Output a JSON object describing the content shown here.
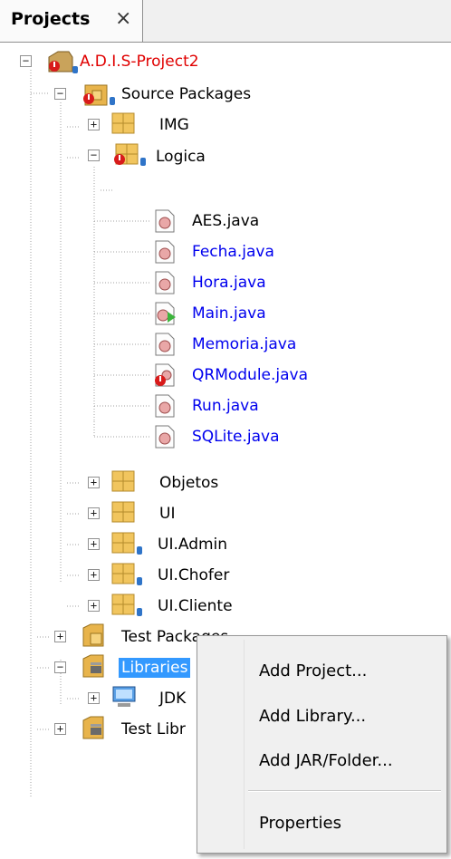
{
  "panel": {
    "title": "Projects",
    "close": "×"
  },
  "tree": {
    "project": "A.D.I.S-Project2",
    "source_packages": "Source Packages",
    "pkg_img": "IMG",
    "pkg_logica": "Logica",
    "files": [
      "AES.java",
      "Fecha.java",
      "Hora.java",
      "Main.java",
      "Memoria.java",
      "QRModule.java",
      "Run.java",
      "SQLite.java"
    ],
    "pkg_objetos": "Objetos",
    "pkg_ui": "UI",
    "pkg_ui_admin": "UI.Admin",
    "pkg_ui_chofer": "UI.Chofer",
    "pkg_ui_cliente": "UI.Cliente",
    "test_packages": "Test Packages",
    "libraries": "Libraries",
    "jdk": "JDK",
    "test_libraries": "Test Libr"
  },
  "context_menu": {
    "add_project": "Add Project...",
    "add_library": "Add Library...",
    "add_jar": "Add JAR/Folder...",
    "properties": "Properties"
  },
  "colors": {
    "selection": "#3399ff",
    "modified": "#0000ee",
    "error": "#e00000"
  }
}
